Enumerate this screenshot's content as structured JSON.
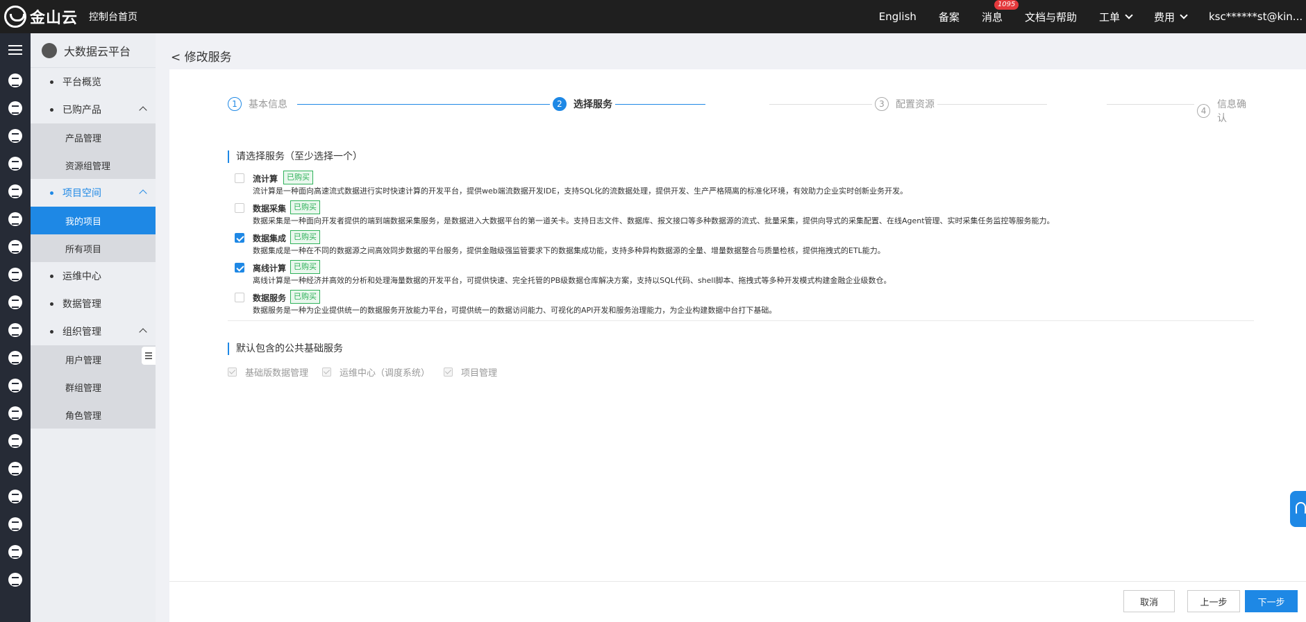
{
  "topbar": {
    "brand": "金山云",
    "console_home": "控制台首页",
    "links": {
      "english": "English",
      "beian": "备案",
      "messages": "消息",
      "messages_count": "1095",
      "docs": "文档与帮助",
      "tickets": "工单",
      "billing": "费用",
      "user": "ksc******st@kin..."
    }
  },
  "sidebar": {
    "title": "大数据云平台",
    "items": [
      {
        "label": "平台概览"
      },
      {
        "label": "已购产品",
        "children": [
          {
            "label": "产品管理"
          },
          {
            "label": "资源组管理"
          }
        ]
      },
      {
        "label": "项目空间",
        "children": [
          {
            "label": "我的项目"
          },
          {
            "label": "所有项目"
          }
        ]
      },
      {
        "label": "运维中心"
      },
      {
        "label": "数据管理"
      },
      {
        "label": "组织管理",
        "children": [
          {
            "label": "用户管理"
          },
          {
            "label": "群组管理"
          },
          {
            "label": "角色管理"
          }
        ]
      }
    ]
  },
  "page": {
    "title": "< 修改服务",
    "steps": [
      {
        "num": "1",
        "label": "基本信息",
        "state": "done"
      },
      {
        "num": "2",
        "label": "选择服务",
        "state": "current"
      },
      {
        "num": "3",
        "label": "配置资源",
        "state": "pending"
      },
      {
        "num": "4",
        "label": "信息确认",
        "state": "pending"
      }
    ],
    "service_section_title": "请选择服务（至少选择一个）",
    "services": [
      {
        "name": "流计算",
        "badge": "已购买",
        "checked": false,
        "desc": "流计算是一种面向高速流式数据进行实时快速计算的开发平台，提供web端流数据开发IDE，支持SQL化的流数据处理，提供开发、生产严格隔离的标准化环境，有效助力企业实时创新业务开发。"
      },
      {
        "name": "数据采集",
        "badge": "已购买",
        "checked": false,
        "desc": "数据采集是一种面向开发者提供的端到端数据采集服务，是数据进入大数据平台的第一道关卡。支持日志文件、数据库、报文接口等多种数据源的流式、批量采集，提供向导式的采集配置、在线Agent管理、实时采集任务监控等服务能力。"
      },
      {
        "name": "数据集成",
        "badge": "已购买",
        "checked": true,
        "desc": "数据集成是一种在不同的数据源之间高效同步数据的平台服务，提供金融级强监管要求下的数据集成功能，支持多种异构数据源的全量、增量数据整合与质量检核，提供拖拽式的ETL能力。"
      },
      {
        "name": "离线计算",
        "badge": "已购买",
        "checked": true,
        "desc": "离线计算是一种经济并高效的分析和处理海量数据的开发平台，可提供快速、完全托管的PB级数据仓库解决方案，支持以SQL代码、shell脚本、拖拽式等多种开发模式构建金融企业级数仓。"
      },
      {
        "name": "数据服务",
        "badge": "已购买",
        "checked": false,
        "desc": "数据服务是一种为企业提供统一的数据服务开放能力平台，可提供统一的数据访问能力、可视化的API开发和服务治理能力，为企业构建数据中台打下基础。"
      }
    ],
    "default_section_title": "默认包含的公共基础服务",
    "defaults": [
      {
        "label": "基础版数据管理"
      },
      {
        "label": "运维中心（调度系统）"
      },
      {
        "label": "项目管理"
      }
    ],
    "buttons": {
      "cancel": "取消",
      "prev": "上一步",
      "next": "下一步"
    }
  },
  "colors": {
    "accent": "#1e88e5",
    "topbar": "#1f1f1f",
    "rail": "#262b36",
    "badge_green": "#2fb15a",
    "badge_red": "#e4393c"
  }
}
